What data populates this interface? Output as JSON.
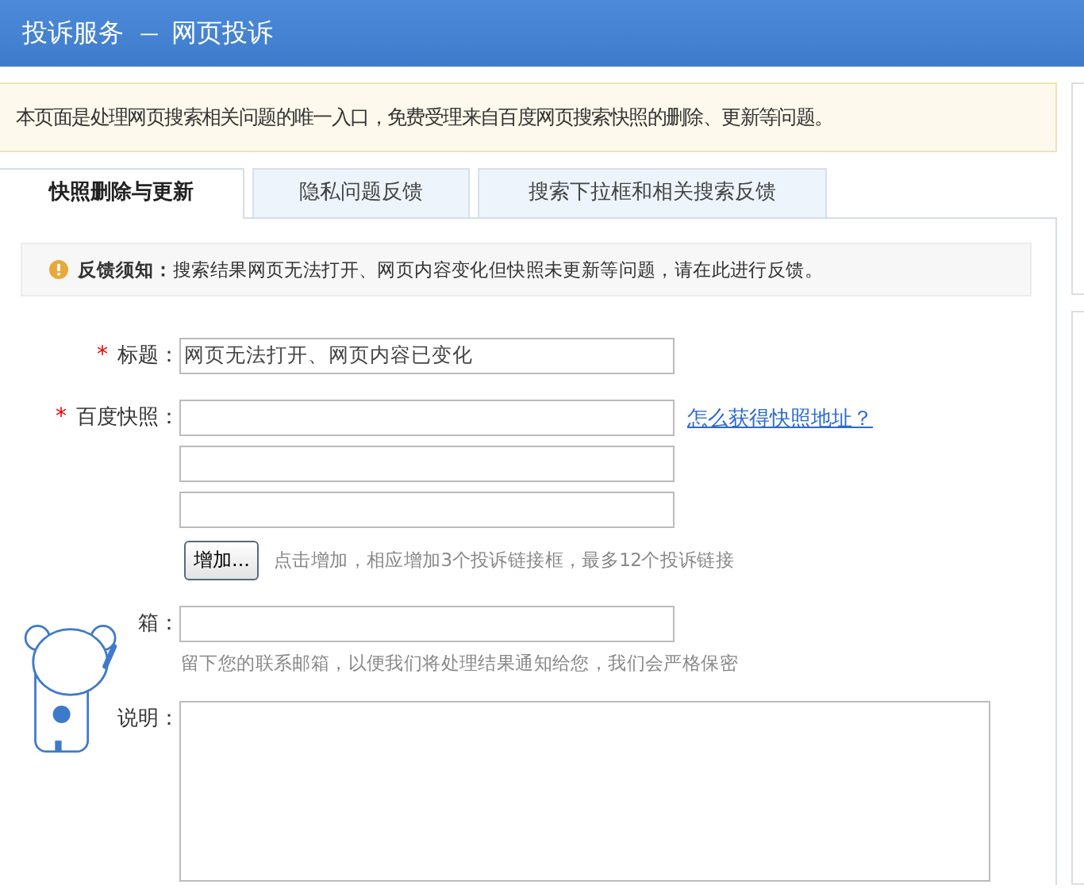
{
  "header": {
    "title": "投诉服务",
    "separator": "—",
    "subtitle": "网页投诉"
  },
  "notice": "本页面是处理网页搜索相关问题的唯一入口，免费受理来自百度网页搜索快照的删除、更新等问题。",
  "tabs": [
    {
      "label": "快照删除与更新",
      "selected": true
    },
    {
      "label": "隐私问题反馈",
      "selected": false
    },
    {
      "label": "搜索下拉框和相关搜索反馈",
      "selected": false
    }
  ],
  "feedback_notice": {
    "label": "反馈须知：",
    "text": "搜索结果网页无法打开、网页内容变化但快照未更新等问题，请在此进行反馈。"
  },
  "form": {
    "title": {
      "required_mark": "*",
      "label": "标题：",
      "value": "网页无法打开、网页内容已变化"
    },
    "snapshot": {
      "required_mark": "*",
      "label": "百度快照：",
      "link": "怎么获得快照地址？",
      "add_button": "增加...",
      "add_hint": "点击增加，相应增加3个投诉链接框，最多12个投诉链接"
    },
    "email": {
      "label": "箱：",
      "hint": "留下您的联系邮箱，以便我们将处理结果通知给您，我们会严格保密"
    },
    "description": {
      "label": "说明："
    }
  }
}
